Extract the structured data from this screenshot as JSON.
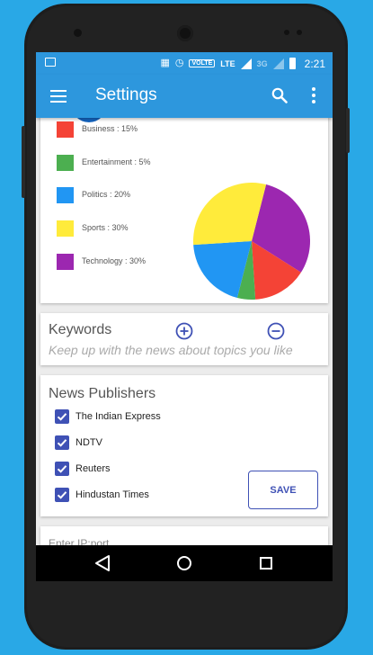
{
  "status_bar": {
    "time": "2:21",
    "volte": "VOLTE",
    "lte": "LTE",
    "network_3g": "3G"
  },
  "app_bar": {
    "title": "Settings"
  },
  "category_chart": {
    "legend": [
      {
        "label": "Business : 15%",
        "color": "#F44336"
      },
      {
        "label": "Entertainment : 5%",
        "color": "#4CAF50"
      },
      {
        "label": "Politics : 20%",
        "color": "#2196F3"
      },
      {
        "label": "Sports : 30%",
        "color": "#FFEB3B"
      },
      {
        "label": "Technology : 30%",
        "color": "#9C27B0"
      }
    ]
  },
  "chart_data": {
    "type": "pie",
    "categories": [
      "Business",
      "Entertainment",
      "Politics",
      "Sports",
      "Technology"
    ],
    "values": [
      15,
      5,
      20,
      30,
      30
    ],
    "colors": [
      "#F44336",
      "#4CAF50",
      "#2196F3",
      "#FFEB3B",
      "#9C27B0"
    ],
    "legend": "left"
  },
  "keywords": {
    "title": "Keywords",
    "hint": "Keep up with the news about topics you like"
  },
  "publishers": {
    "title": "News Publishers",
    "items": [
      {
        "label": "The Indian Express",
        "checked": true
      },
      {
        "label": "NDTV",
        "checked": true
      },
      {
        "label": "Reuters",
        "checked": true
      },
      {
        "label": "Hindustan Times",
        "checked": true
      }
    ],
    "save_label": "SAVE"
  },
  "ip_card": {
    "hint": "Enter IP:port"
  },
  "colors": {
    "primary": "#2D97DD",
    "accent": "#3F51B5",
    "background": "#29A8E6"
  }
}
